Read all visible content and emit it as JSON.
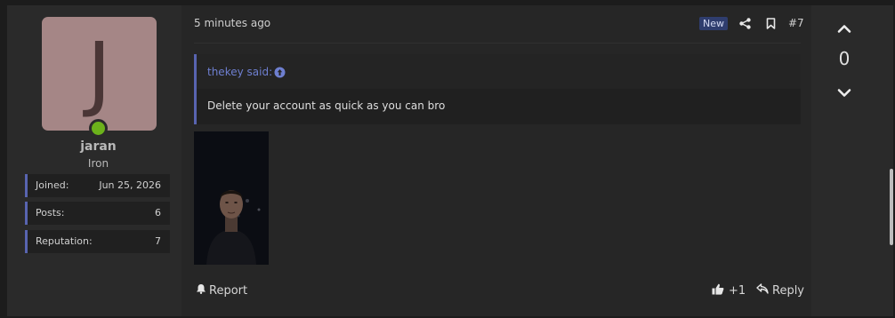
{
  "post": {
    "date": "5 minutes ago",
    "badge": "New",
    "number": "#7",
    "icons": {
      "share": "share-icon",
      "bookmark": "bookmark-icon"
    }
  },
  "user": {
    "avatar_letter": "J",
    "avatar_color": "#a58686",
    "online_color": "#6cb21b",
    "name": "jaran",
    "title": "Iron",
    "stats": [
      {
        "label": "Joined:",
        "value": "Jun 25, 2026"
      },
      {
        "label": "Posts:",
        "value": "6"
      },
      {
        "label": "Reputation:",
        "value": "7"
      }
    ]
  },
  "quote": {
    "author": "thekey said:",
    "text": "Delete your account as quick as you can bro"
  },
  "footer": {
    "report": "Report",
    "like_count": "+1",
    "reply": "Reply"
  },
  "vote": {
    "score": "0"
  },
  "colors": {
    "accent": "#5864b0",
    "link": "#6e7fd0",
    "badge_bg": "#2f3d6e"
  }
}
